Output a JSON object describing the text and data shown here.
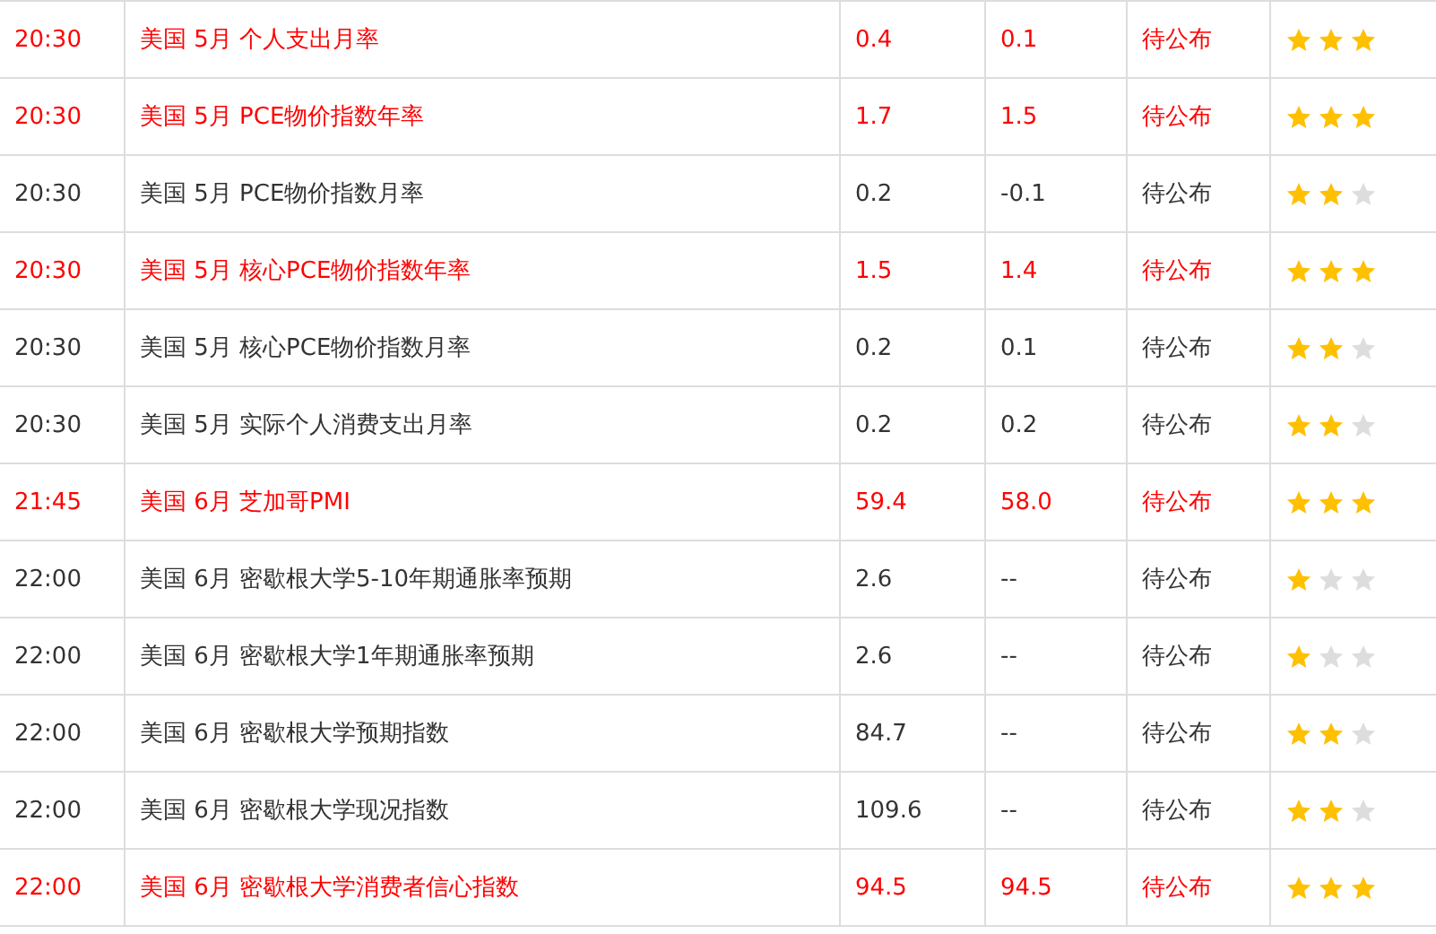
{
  "rows": [
    {
      "time": "20:30",
      "event": "美国 5月 个人支出月率",
      "previous": "0.4",
      "forecast": "0.1",
      "actual": "待公布",
      "stars": 3,
      "highlighted": true
    },
    {
      "time": "20:30",
      "event": "美国 5月 PCE物价指数年率",
      "previous": "1.7",
      "forecast": "1.5",
      "actual": "待公布",
      "stars": 3,
      "highlighted": true
    },
    {
      "time": "20:30",
      "event": "美国 5月 PCE物价指数月率",
      "previous": "0.2",
      "forecast": "-0.1",
      "actual": "待公布",
      "stars": 2,
      "highlighted": false
    },
    {
      "time": "20:30",
      "event": "美国 5月 核心PCE物价指数年率",
      "previous": "1.5",
      "forecast": "1.4",
      "actual": "待公布",
      "stars": 3,
      "highlighted": true
    },
    {
      "time": "20:30",
      "event": "美国 5月 核心PCE物价指数月率",
      "previous": "0.2",
      "forecast": "0.1",
      "actual": "待公布",
      "stars": 2,
      "highlighted": false
    },
    {
      "time": "20:30",
      "event": "美国 5月 实际个人消费支出月率",
      "previous": "0.2",
      "forecast": "0.2",
      "actual": "待公布",
      "stars": 2,
      "highlighted": false
    },
    {
      "time": "21:45",
      "event": "美国 6月 芝加哥PMI",
      "previous": "59.4",
      "forecast": "58.0",
      "actual": "待公布",
      "stars": 3,
      "highlighted": true
    },
    {
      "time": "22:00",
      "event": "美国 6月 密歇根大学5-10年期通胀率预期",
      "previous": "2.6",
      "forecast": "--",
      "actual": "待公布",
      "stars": 1,
      "highlighted": false
    },
    {
      "time": "22:00",
      "event": "美国 6月 密歇根大学1年期通胀率预期",
      "previous": "2.6",
      "forecast": "--",
      "actual": "待公布",
      "stars": 1,
      "highlighted": false
    },
    {
      "time": "22:00",
      "event": "美国 6月 密歇根大学预期指数",
      "previous": "84.7",
      "forecast": "--",
      "actual": "待公布",
      "stars": 2,
      "highlighted": false
    },
    {
      "time": "22:00",
      "event": "美国 6月 密歇根大学现况指数",
      "previous": "109.6",
      "forecast": "--",
      "actual": "待公布",
      "stars": 2,
      "highlighted": false
    },
    {
      "time": "22:00",
      "event": "美国 6月 密歇根大学消费者信心指数",
      "previous": "94.5",
      "forecast": "94.5",
      "actual": "待公布",
      "stars": 3,
      "highlighted": true
    }
  ]
}
